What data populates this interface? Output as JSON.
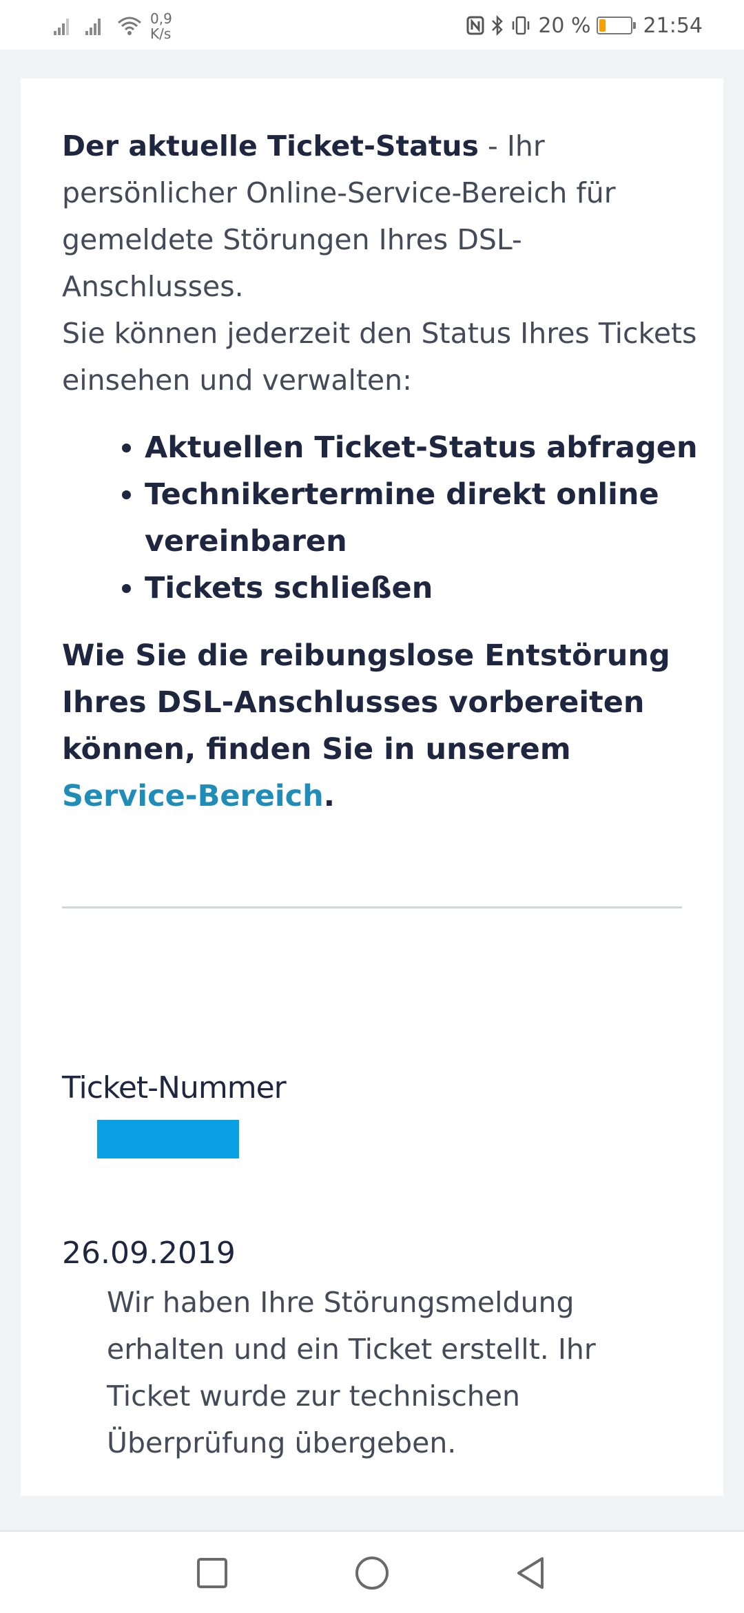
{
  "status_bar": {
    "speed_value": "0,9",
    "speed_unit": "K/s",
    "battery_percent_label": "20 %",
    "battery_level": 0.2,
    "time": "21:54",
    "icons": [
      "signal-icon",
      "signal-icon",
      "wifi-icon",
      "nfc-icon",
      "bluetooth-icon",
      "vibrate-icon",
      "battery-icon"
    ]
  },
  "intro": {
    "title": "Der aktuelle Ticket-Status",
    "text": " - Ihr persönlicher Online-Service-Bereich für gemeldete Störungen Ihres DSL-Anschlusses.",
    "text2": "Sie können jederzeit den Status Ihres Tickets einsehen und verwalten:"
  },
  "features": [
    "Aktuellen Ticket-Status abfragen",
    "Technikertermine direkt online vereinbaren",
    "Tickets schließen"
  ],
  "prep": {
    "text": "Wie Sie die reibungslose Entstörung Ihres DSL-Anschlusses vorbereiten können, finden Sie in unserem ",
    "link_label": "Service-Bereich",
    "end": "."
  },
  "ticket": {
    "label": "Ticket-Nummer"
  },
  "history": [
    {
      "date": "26.09.2019",
      "text": "Wir haben Ihre Störungsmeldung erhalten und ein Ticket erstellt. Ihr Ticket wurde zur technischen Überprüfung übergeben."
    }
  ],
  "colors": {
    "link": "#1f8db8",
    "text_dark": "#1e2640",
    "redaction": "#0aa0e4",
    "battery_fill": "#f5a000"
  }
}
